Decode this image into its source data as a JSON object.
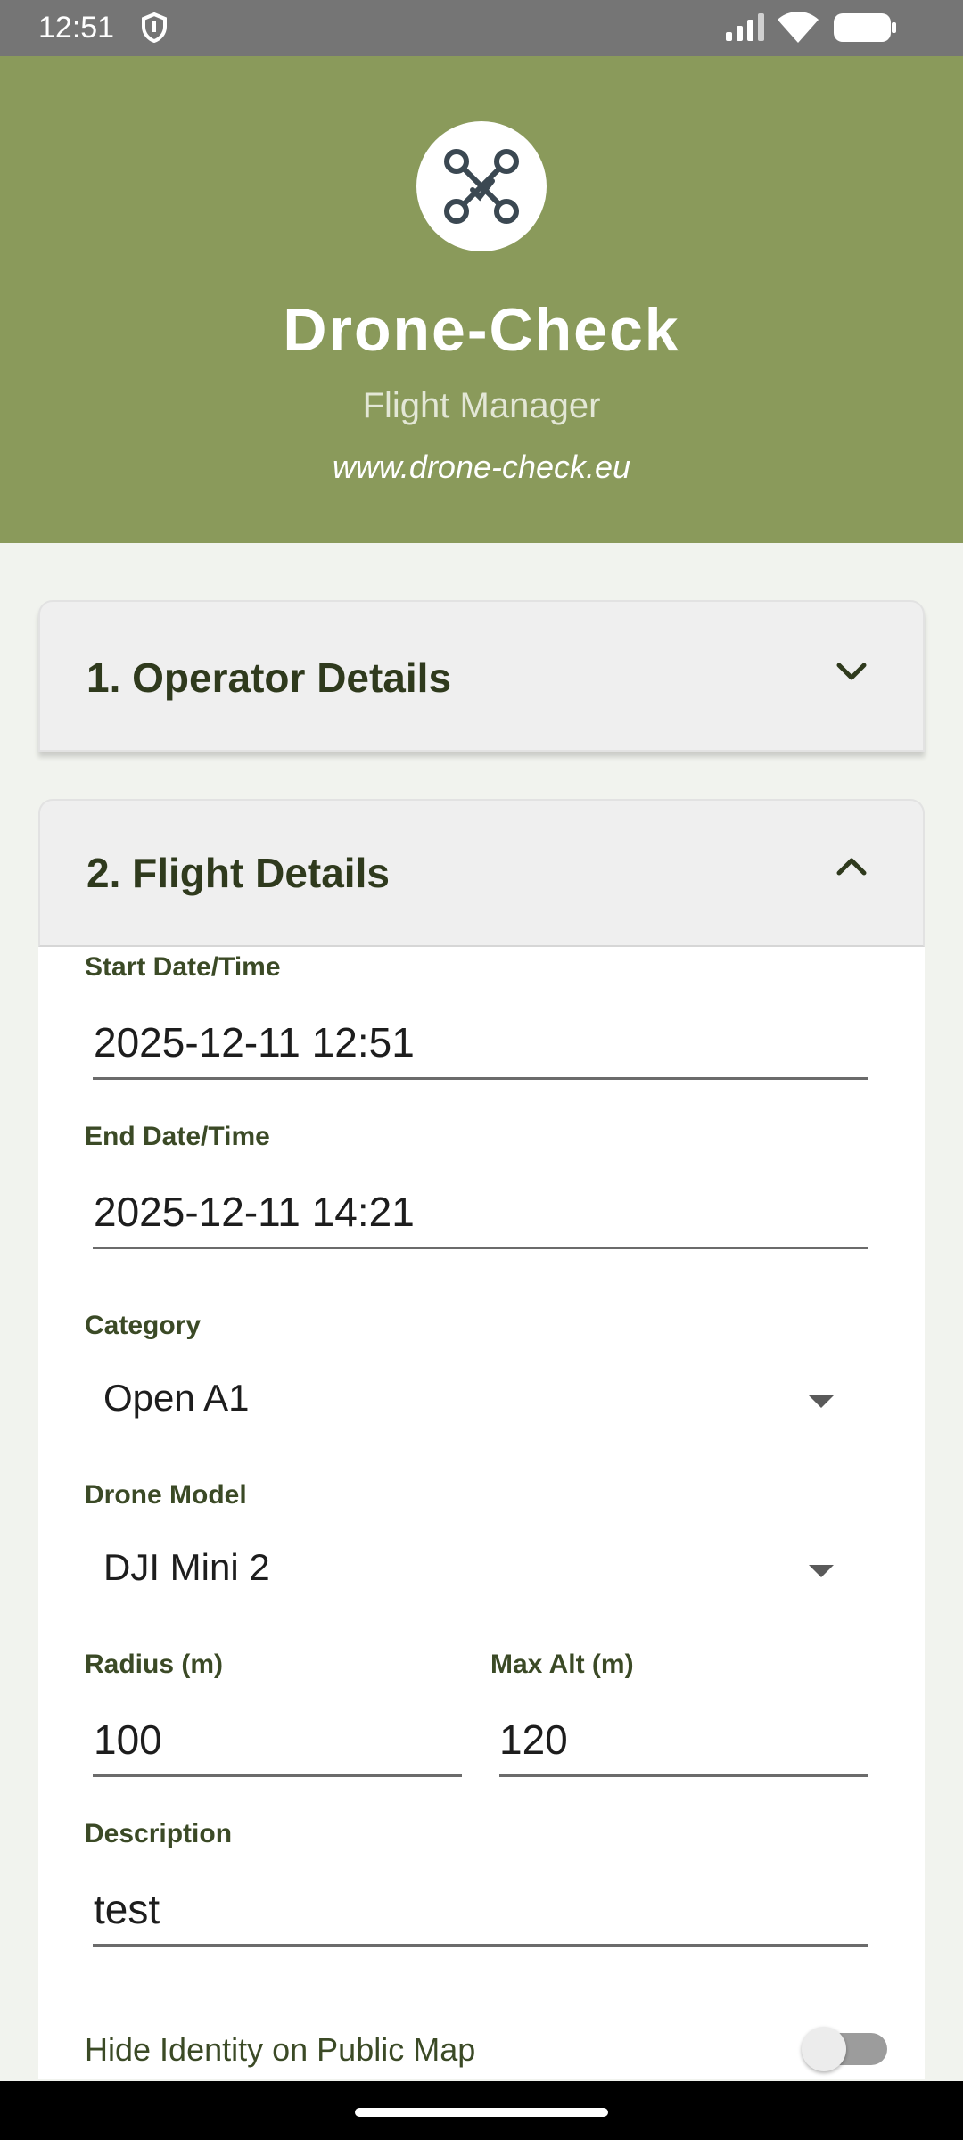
{
  "status_bar": {
    "time": "12:51",
    "icons": [
      "shield-icon",
      "signal-icon",
      "wifi-icon",
      "battery-icon"
    ]
  },
  "header": {
    "logo_icon": "drone-icon",
    "title": "Drone-Check",
    "subtitle": "Flight Manager",
    "url": "www.drone-check.eu",
    "background_color": "#8a9a5b"
  },
  "sections": {
    "operator": {
      "title": "1. Operator Details",
      "expanded": false
    },
    "flight": {
      "title": "2. Flight Details",
      "expanded": true
    }
  },
  "flight_form": {
    "start": {
      "label": "Start Date/Time",
      "value": "2025-12-11 12:51"
    },
    "end": {
      "label": "End Date/Time",
      "value": "2025-12-11 14:21"
    },
    "category": {
      "label": "Category",
      "value": "Open A1"
    },
    "drone_model": {
      "label": "Drone Model",
      "value": "DJI Mini 2"
    },
    "radius": {
      "label": "Radius (m)",
      "value": "100"
    },
    "max_alt": {
      "label": "Max Alt (m)",
      "value": "120"
    },
    "description": {
      "label": "Description",
      "value": "test"
    },
    "hide_identity": {
      "label": "Hide Identity on Public Map",
      "checked": false
    }
  },
  "colors": {
    "accent": "#8a9a5b",
    "text_dark": "#2f3a1d"
  }
}
